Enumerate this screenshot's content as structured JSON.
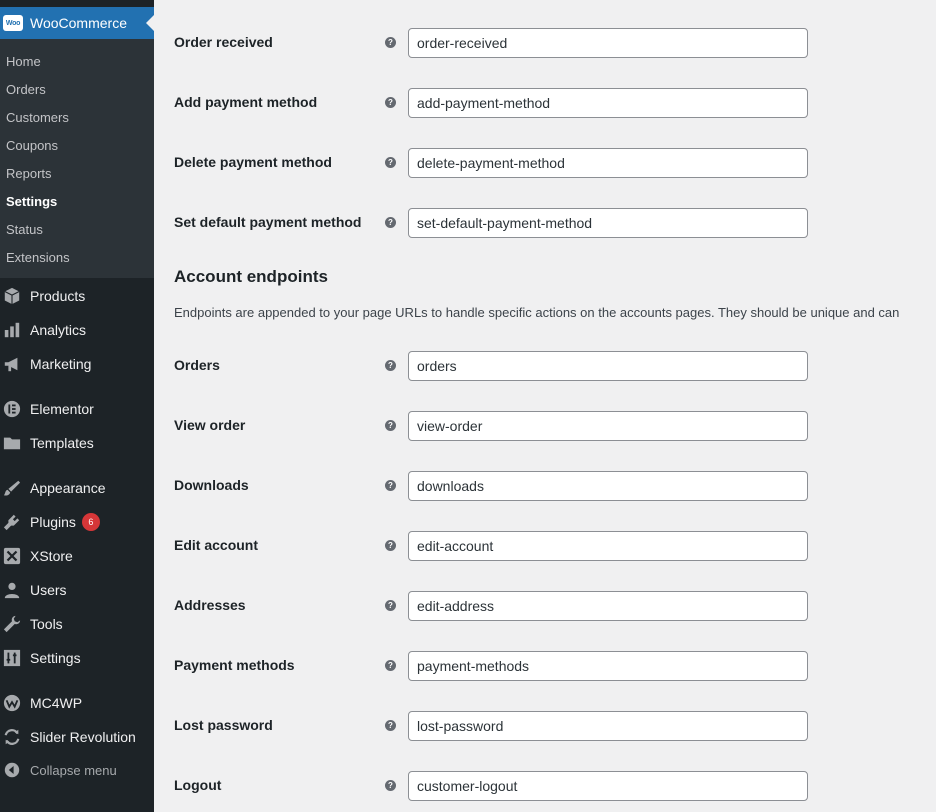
{
  "sidebar": {
    "woocommerce_label": "WooCommerce",
    "woo_logo_text": "Woo",
    "submenu": [
      "Home",
      "Orders",
      "Customers",
      "Coupons",
      "Reports",
      "Settings",
      "Status",
      "Extensions"
    ],
    "menu": {
      "products": "Products",
      "analytics": "Analytics",
      "marketing": "Marketing",
      "elementor": "Elementor",
      "templates": "Templates",
      "appearance": "Appearance",
      "plugins": "Plugins",
      "plugins_badge": "6",
      "xstore": "XStore",
      "users": "Users",
      "tools": "Tools",
      "settings": "Settings",
      "mc4wp": "MC4WP",
      "slider_revolution": "Slider Revolution",
      "collapse": "Collapse menu"
    }
  },
  "checkout_endpoints": [
    {
      "label": "Order received",
      "value": "order-received"
    },
    {
      "label": "Add payment method",
      "value": "add-payment-method"
    },
    {
      "label": "Delete payment method",
      "value": "delete-payment-method"
    },
    {
      "label": "Set default payment method",
      "value": "set-default-payment-method"
    }
  ],
  "account_section": {
    "title": "Account endpoints",
    "description": "Endpoints are appended to your page URLs to handle specific actions on the accounts pages. They should be unique and can"
  },
  "account_endpoints": [
    {
      "label": "Orders",
      "value": "orders"
    },
    {
      "label": "View order",
      "value": "view-order"
    },
    {
      "label": "Downloads",
      "value": "downloads"
    },
    {
      "label": "Edit account",
      "value": "edit-account"
    },
    {
      "label": "Addresses",
      "value": "edit-address"
    },
    {
      "label": "Payment methods",
      "value": "payment-methods"
    },
    {
      "label": "Lost password",
      "value": "lost-password"
    },
    {
      "label": "Logout",
      "value": "customer-logout"
    }
  ],
  "help_glyph": "?",
  "colors": {
    "sidebar_bg": "#1d2327",
    "submenu_bg": "#2c3338",
    "accent": "#2271b1",
    "badge": "#d63638"
  }
}
